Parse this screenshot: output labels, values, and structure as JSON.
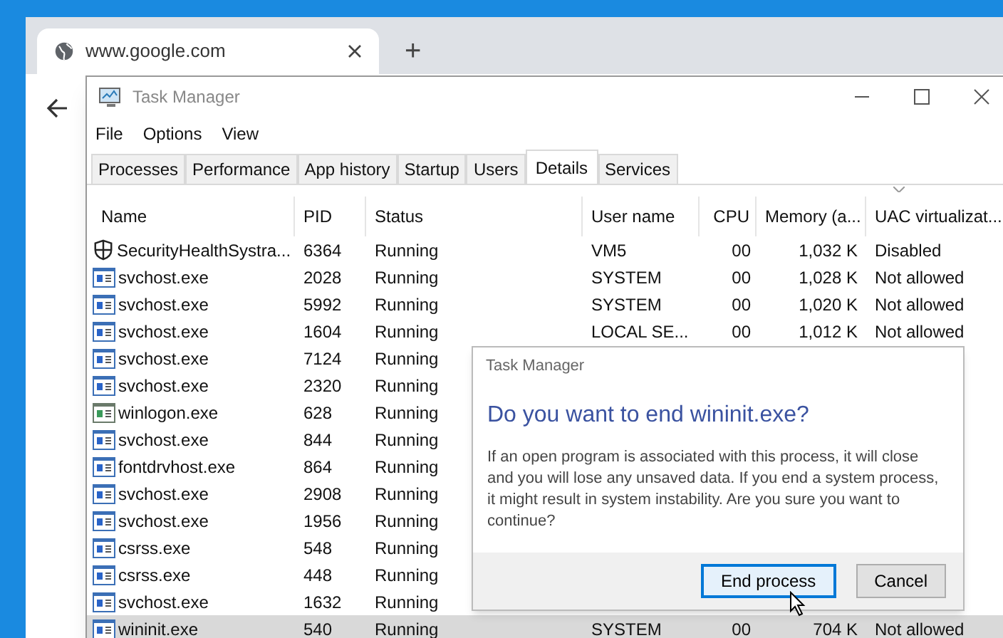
{
  "browser": {
    "tab_title": "www.google.com",
    "new_tab": "+"
  },
  "window": {
    "title": "Task Manager"
  },
  "menu": [
    "File",
    "Options",
    "View"
  ],
  "tabs": [
    {
      "label": "Processes",
      "selected": false
    },
    {
      "label": "Performance",
      "selected": false
    },
    {
      "label": "App history",
      "selected": false
    },
    {
      "label": "Startup",
      "selected": false
    },
    {
      "label": "Users",
      "selected": false
    },
    {
      "label": "Details",
      "selected": true
    },
    {
      "label": "Services",
      "selected": false
    }
  ],
  "table": {
    "columns": [
      "Name",
      "PID",
      "Status",
      "User name",
      "CPU",
      "Memory (a...",
      "UAC virtualizat..."
    ],
    "rows": [
      {
        "kind": "shield",
        "cells": [
          "SecurityHealthSystra...",
          "6364",
          "Running",
          "VM5",
          "00",
          "1,032 K",
          "Disabled"
        ],
        "selected": false
      },
      {
        "kind": "app",
        "cells": [
          "svchost.exe",
          "2028",
          "Running",
          "SYSTEM",
          "00",
          "1,028 K",
          "Not allowed"
        ],
        "selected": false
      },
      {
        "kind": "app",
        "cells": [
          "svchost.exe",
          "5992",
          "Running",
          "SYSTEM",
          "00",
          "1,020 K",
          "Not allowed"
        ],
        "selected": false
      },
      {
        "kind": "app",
        "cells": [
          "svchost.exe",
          "1604",
          "Running",
          "LOCAL SE...",
          "00",
          "1,012 K",
          "Not allowed"
        ],
        "selected": false
      },
      {
        "kind": "app",
        "cells": [
          "svchost.exe",
          "7124",
          "Running"
        ],
        "selected": false
      },
      {
        "kind": "app",
        "cells": [
          "svchost.exe",
          "2320",
          "Running"
        ],
        "selected": false
      },
      {
        "kind": "console",
        "cells": [
          "winlogon.exe",
          "628",
          "Running"
        ],
        "selected": false
      },
      {
        "kind": "app",
        "cells": [
          "svchost.exe",
          "844",
          "Running"
        ],
        "selected": false
      },
      {
        "kind": "app",
        "cells": [
          "fontdrvhost.exe",
          "864",
          "Running"
        ],
        "selected": false
      },
      {
        "kind": "app",
        "cells": [
          "svchost.exe",
          "2908",
          "Running"
        ],
        "selected": false
      },
      {
        "kind": "app",
        "cells": [
          "svchost.exe",
          "1956",
          "Running"
        ],
        "selected": false
      },
      {
        "kind": "app",
        "cells": [
          "csrss.exe",
          "548",
          "Running"
        ],
        "selected": false
      },
      {
        "kind": "app",
        "cells": [
          "csrss.exe",
          "448",
          "Running"
        ],
        "selected": false
      },
      {
        "kind": "app",
        "cells": [
          "svchost.exe",
          "1632",
          "Running"
        ],
        "selected": false
      },
      {
        "kind": "app",
        "cells": [
          "wininit.exe",
          "540",
          "Running",
          "SYSTEM",
          "00",
          "704 K",
          "Not allowed"
        ],
        "selected": true
      }
    ]
  },
  "dialog": {
    "title": "Task Manager",
    "heading": "Do you want to end wininit.exe?",
    "body": "If an open program is associated with this process, it will close and you will lose any unsaved data. If you end a system process, it might result in system instability. Are you sure you want to continue?",
    "buttons": [
      {
        "label": "End process",
        "selected": true
      },
      {
        "label": "Cancel",
        "selected": false
      }
    ]
  }
}
